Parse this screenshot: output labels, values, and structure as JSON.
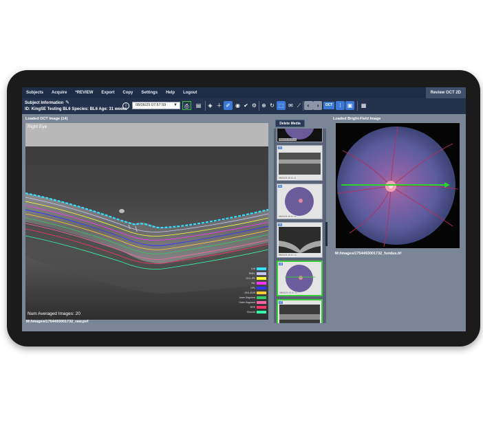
{
  "menu": {
    "items": [
      "Subjects",
      "Acquire",
      "*REVIEW",
      "Export",
      "Copy",
      "Settings",
      "Help",
      "Logout"
    ],
    "active_mode": "Review OCT 2D"
  },
  "subject": {
    "title": "Subject Information",
    "details": "ID: KingSE Testing BL6 Species: BL6 Age: 31 weeks"
  },
  "toolbar": {
    "date_value": "08/06/25 07:57:59",
    "oct_label": "OCT",
    "icons": [
      "info-icon",
      "save-icon",
      "clipboard-icon",
      "layers-icon",
      "plus-icon",
      "marker-icon",
      "eye-icon",
      "check-icon",
      "settings-icon",
      "zoom-icon",
      "refresh-icon",
      "select-icon",
      "comment-icon",
      "ruler-icon",
      "brightness-icon",
      "contrast-icon",
      "grid-icon",
      "photo-icon",
      "report-icon"
    ]
  },
  "oct": {
    "header": "Loaded OCT Image (14)",
    "eye_label": "Right Eye",
    "averaged": "Num Averaged Images: 20",
    "path": "M:/images/1754493001732_raw.pvf",
    "legend": [
      {
        "label": "ILM",
        "color": "#33e0ff"
      },
      {
        "label": "RNFL",
        "color": "#c8c8ff"
      },
      {
        "label": "GCL-IPL",
        "color": "#ffff33"
      },
      {
        "label": "INL",
        "color": "#ff33ff"
      },
      {
        "label": "OPL",
        "color": "#3333ff"
      },
      {
        "label": "ONL-ELM",
        "color": "#ffcc33"
      },
      {
        "label": "Inner Segment",
        "color": "#33cc66"
      },
      {
        "label": "Outer Segment",
        "color": "#ff66aa"
      },
      {
        "label": "RPE",
        "color": "#ff3366"
      },
      {
        "label": "Choroid",
        "color": "#33ffaa"
      }
    ]
  },
  "media": {
    "delete_label": "Delete Media",
    "thumbnails": [
      {
        "num": "12",
        "caption": "08/06/25 08:10:41",
        "kind": "fundus"
      },
      {
        "num": "13",
        "caption": "08/06/25 08:10:41",
        "kind": "oct"
      },
      {
        "num": "14",
        "caption": "08/06/25 08:10:10",
        "kind": "fundus"
      },
      {
        "num": "15",
        "caption": "08/06/25 08:10:14",
        "kind": "oct"
      },
      {
        "num": "16",
        "caption": "08/06/25 08:10:10",
        "kind": "fundus"
      },
      {
        "num": "17",
        "caption": "",
        "kind": "oct"
      }
    ]
  },
  "fundus": {
    "header": "Loaded Bright-Field Image",
    "path": "M:/images/1754493001732_fundus.tif"
  }
}
